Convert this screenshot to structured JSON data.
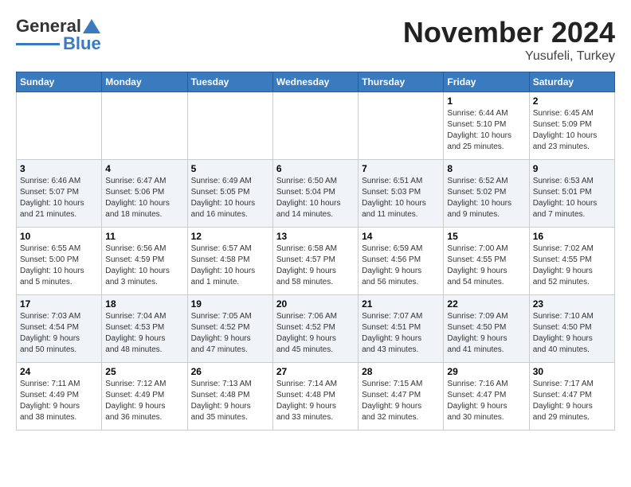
{
  "logo": {
    "general": "General",
    "blue": "Blue"
  },
  "header": {
    "month": "November 2024",
    "location": "Yusufeli, Turkey"
  },
  "weekdays": [
    "Sunday",
    "Monday",
    "Tuesday",
    "Wednesday",
    "Thursday",
    "Friday",
    "Saturday"
  ],
  "weeks": [
    [
      {
        "day": "",
        "info": ""
      },
      {
        "day": "",
        "info": ""
      },
      {
        "day": "",
        "info": ""
      },
      {
        "day": "",
        "info": ""
      },
      {
        "day": "",
        "info": ""
      },
      {
        "day": "1",
        "info": "Sunrise: 6:44 AM\nSunset: 5:10 PM\nDaylight: 10 hours\nand 25 minutes."
      },
      {
        "day": "2",
        "info": "Sunrise: 6:45 AM\nSunset: 5:09 PM\nDaylight: 10 hours\nand 23 minutes."
      }
    ],
    [
      {
        "day": "3",
        "info": "Sunrise: 6:46 AM\nSunset: 5:07 PM\nDaylight: 10 hours\nand 21 minutes."
      },
      {
        "day": "4",
        "info": "Sunrise: 6:47 AM\nSunset: 5:06 PM\nDaylight: 10 hours\nand 18 minutes."
      },
      {
        "day": "5",
        "info": "Sunrise: 6:49 AM\nSunset: 5:05 PM\nDaylight: 10 hours\nand 16 minutes."
      },
      {
        "day": "6",
        "info": "Sunrise: 6:50 AM\nSunset: 5:04 PM\nDaylight: 10 hours\nand 14 minutes."
      },
      {
        "day": "7",
        "info": "Sunrise: 6:51 AM\nSunset: 5:03 PM\nDaylight: 10 hours\nand 11 minutes."
      },
      {
        "day": "8",
        "info": "Sunrise: 6:52 AM\nSunset: 5:02 PM\nDaylight: 10 hours\nand 9 minutes."
      },
      {
        "day": "9",
        "info": "Sunrise: 6:53 AM\nSunset: 5:01 PM\nDaylight: 10 hours\nand 7 minutes."
      }
    ],
    [
      {
        "day": "10",
        "info": "Sunrise: 6:55 AM\nSunset: 5:00 PM\nDaylight: 10 hours\nand 5 minutes."
      },
      {
        "day": "11",
        "info": "Sunrise: 6:56 AM\nSunset: 4:59 PM\nDaylight: 10 hours\nand 3 minutes."
      },
      {
        "day": "12",
        "info": "Sunrise: 6:57 AM\nSunset: 4:58 PM\nDaylight: 10 hours\nand 1 minute."
      },
      {
        "day": "13",
        "info": "Sunrise: 6:58 AM\nSunset: 4:57 PM\nDaylight: 9 hours\nand 58 minutes."
      },
      {
        "day": "14",
        "info": "Sunrise: 6:59 AM\nSunset: 4:56 PM\nDaylight: 9 hours\nand 56 minutes."
      },
      {
        "day": "15",
        "info": "Sunrise: 7:00 AM\nSunset: 4:55 PM\nDaylight: 9 hours\nand 54 minutes."
      },
      {
        "day": "16",
        "info": "Sunrise: 7:02 AM\nSunset: 4:55 PM\nDaylight: 9 hours\nand 52 minutes."
      }
    ],
    [
      {
        "day": "17",
        "info": "Sunrise: 7:03 AM\nSunset: 4:54 PM\nDaylight: 9 hours\nand 50 minutes."
      },
      {
        "day": "18",
        "info": "Sunrise: 7:04 AM\nSunset: 4:53 PM\nDaylight: 9 hours\nand 48 minutes."
      },
      {
        "day": "19",
        "info": "Sunrise: 7:05 AM\nSunset: 4:52 PM\nDaylight: 9 hours\nand 47 minutes."
      },
      {
        "day": "20",
        "info": "Sunrise: 7:06 AM\nSunset: 4:52 PM\nDaylight: 9 hours\nand 45 minutes."
      },
      {
        "day": "21",
        "info": "Sunrise: 7:07 AM\nSunset: 4:51 PM\nDaylight: 9 hours\nand 43 minutes."
      },
      {
        "day": "22",
        "info": "Sunrise: 7:09 AM\nSunset: 4:50 PM\nDaylight: 9 hours\nand 41 minutes."
      },
      {
        "day": "23",
        "info": "Sunrise: 7:10 AM\nSunset: 4:50 PM\nDaylight: 9 hours\nand 40 minutes."
      }
    ],
    [
      {
        "day": "24",
        "info": "Sunrise: 7:11 AM\nSunset: 4:49 PM\nDaylight: 9 hours\nand 38 minutes."
      },
      {
        "day": "25",
        "info": "Sunrise: 7:12 AM\nSunset: 4:49 PM\nDaylight: 9 hours\nand 36 minutes."
      },
      {
        "day": "26",
        "info": "Sunrise: 7:13 AM\nSunset: 4:48 PM\nDaylight: 9 hours\nand 35 minutes."
      },
      {
        "day": "27",
        "info": "Sunrise: 7:14 AM\nSunset: 4:48 PM\nDaylight: 9 hours\nand 33 minutes."
      },
      {
        "day": "28",
        "info": "Sunrise: 7:15 AM\nSunset: 4:47 PM\nDaylight: 9 hours\nand 32 minutes."
      },
      {
        "day": "29",
        "info": "Sunrise: 7:16 AM\nSunset: 4:47 PM\nDaylight: 9 hours\nand 30 minutes."
      },
      {
        "day": "30",
        "info": "Sunrise: 7:17 AM\nSunset: 4:47 PM\nDaylight: 9 hours\nand 29 minutes."
      }
    ]
  ]
}
